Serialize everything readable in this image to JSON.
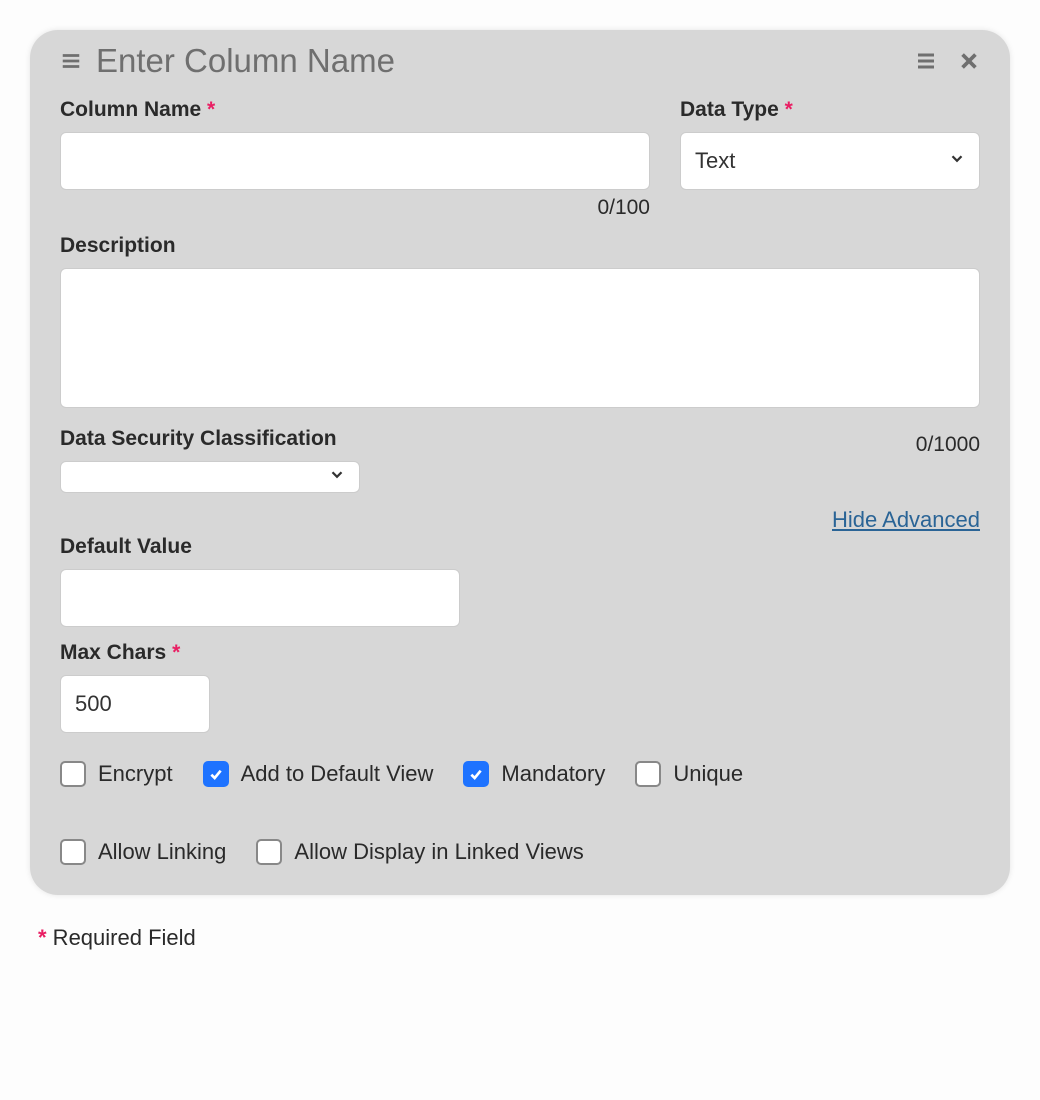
{
  "header": {
    "title": "Enter Column Name"
  },
  "labels": {
    "column_name": "Column Name",
    "data_type": "Data Type",
    "description": "Description",
    "dsc": "Data Security Classification",
    "default_value": "Default Value",
    "max_chars": "Max Chars"
  },
  "values": {
    "column_name": "",
    "data_type_selected": "Text",
    "description": "",
    "dsc_selected": "",
    "default_value": "",
    "max_chars": "500"
  },
  "counters": {
    "column_name": "0/100",
    "description": "0/1000"
  },
  "link": {
    "hide_advanced": "Hide Advanced"
  },
  "checkboxes": {
    "encrypt": {
      "label": "Encrypt",
      "checked": false
    },
    "add_default_view": {
      "label": "Add to Default View",
      "checked": true
    },
    "mandatory": {
      "label": "Mandatory",
      "checked": true
    },
    "unique": {
      "label": "Unique",
      "checked": false
    },
    "allow_linking": {
      "label": "Allow Linking",
      "checked": false
    },
    "allow_display_linked": {
      "label": "Allow Display in Linked Views",
      "checked": false
    }
  },
  "footnote": {
    "asterisk": "*",
    "text": " Required Field"
  }
}
